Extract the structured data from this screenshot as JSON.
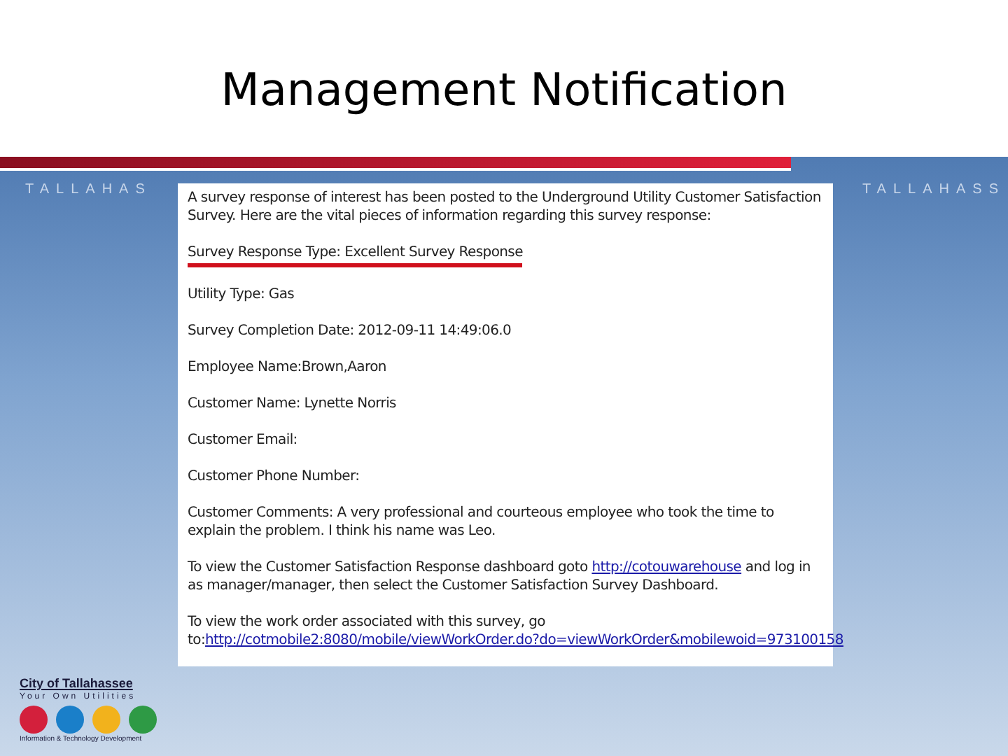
{
  "slide_title": "Management Notification",
  "banner_text": [
    "TALLAHAS",
    "TALLAHASS"
  ],
  "email": [
    {
      "underlined": false,
      "text": "A survey response of interest has been posted to the Underground Utility Customer Satisfaction Survey. Here are the vital pieces of information regarding this survey response:"
    },
    {
      "underlined": true,
      "text": "Survey Response Type: Excellent Survey Response"
    },
    {
      "underlined": false,
      "text": "Utility Type: Gas"
    },
    {
      "underlined": false,
      "text": "Survey Completion Date: 2012-09-11 14:49:06.0"
    },
    {
      "underlined": false,
      "text": "Employee Name:Brown,Aaron"
    },
    {
      "underlined": false,
      "text": "Customer Name: Lynette Norris"
    },
    {
      "underlined": false,
      "text": "Customer Email:"
    },
    {
      "underlined": false,
      "text": "Customer Phone Number:"
    },
    {
      "underlined": false,
      "text": "Customer Comments: A very professional and courteous employee who took the time to explain the problem. I think his name was Leo."
    },
    {
      "underlined": false,
      "text": "To view the Customer Satisfaction Response dashboard goto ",
      "link": "http://cotouwarehouse",
      "text_after": " and log in as manager/manager, then select the Customer Satisfaction Survey Dashboard."
    },
    {
      "underlined": false,
      "text": "To view the work order associated with this survey, go to:",
      "link": "http://cotmobile2:8080/mobile/viewWorkOrder.do?do=viewWorkOrder&mobilewoid=973100158"
    }
  ],
  "logo": {
    "name": "City of Tallahassee",
    "tagline": "Your Own Utilities",
    "department": "Information & Technology Development"
  }
}
